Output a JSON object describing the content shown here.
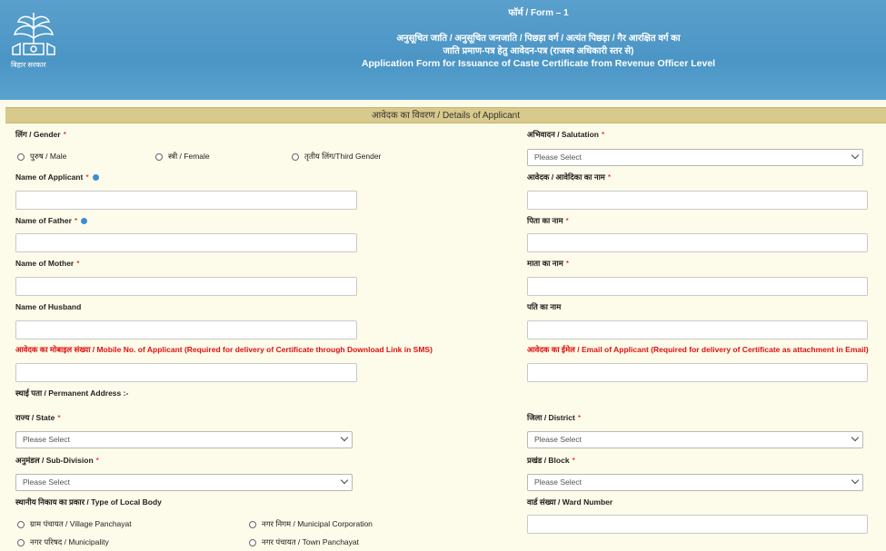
{
  "header": {
    "logo_caption": "बिहार सरकार",
    "form_no": "फॉर्म / Form – 1",
    "title_hi_1": "अनुसूचित जाति / अनुसूचित जनजाति / पिछड़ा वर्ग / अत्यंत पिछड़ा / गैर आरक्षित वर्ग का",
    "title_hi_2": "जाति प्रमाण-पत्र हेतु आवेदन-पत्र (राजस्व अधिकारी स्तर से)",
    "title_en": "Application Form for Issuance of Caste Certificate from Revenue Officer Level"
  },
  "section": {
    "title": "आवेदक का विवरण / Details of Applicant"
  },
  "fields": {
    "gender_label": "लिंग / Gender",
    "gender_options": [
      "पुरुष / Male",
      "स्त्री / Female",
      "तृतीय लिंग/Third Gender"
    ],
    "salutation_label": "अभिवादन / Salutation",
    "salutation_value": "Please Select",
    "name_applicant_label": "Name of Applicant",
    "name_applicant_hi_label": "आवेदक / आवेदिका का नाम",
    "name_father_label": "Name of Father",
    "name_father_hi_label": "पिता का नाम",
    "name_mother_label": "Name of Mother",
    "name_mother_hi_label": "माता का नाम",
    "name_husband_label": "Name of Husband",
    "name_husband_hi_label": "पति का नाम",
    "mobile_label": "आवेदक का मोबाइल संख्या / Mobile No. of Applicant (Required for delivery of Certificate through Download Link in SMS)",
    "email_label": "आवेदक का ईमेल / Email of Applicant (Required for delivery of Certificate as attachment in Email)",
    "permanent_address_label": "स्थाई पता / Permanent Address :-",
    "state_label": "राज्य / State",
    "state_value": "Please Select",
    "district_label": "जिला / District",
    "district_value": "Please Select",
    "subdivision_label": "अनुमंडल / Sub-Division",
    "subdivision_value": "Please Select",
    "block_label": "प्रखंड / Block",
    "block_value": "Please Select",
    "local_body_label": "स्थानीय निकाय का प्रकार / Type of Local Body",
    "local_body_options": [
      "ग्राम पंचायत / Village Panchayat",
      "नगर निगम / Municipal Corporation",
      "नगर परिषद / Municipality",
      "नगर पंचायत / Town Panchayat"
    ],
    "ward_label": "वार्ड संख्या / Ward Number",
    "required_mark": "*"
  }
}
